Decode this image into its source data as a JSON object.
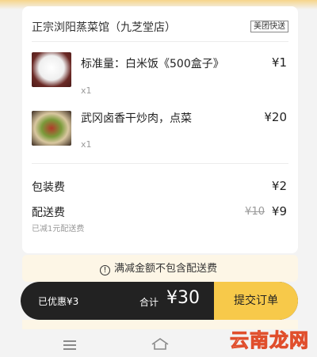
{
  "shop": {
    "name": "正宗浏阳蒸菜馆（九芝堂店）",
    "delivery_badge": "美团快送"
  },
  "items": [
    {
      "name": "标准量：白米饭《500盒子》",
      "price": "¥1",
      "qty": "x1",
      "thumb_icon": "rice-image"
    },
    {
      "name": "武冈卤香干炒肉，点菜",
      "price": "¥20",
      "qty": "x1",
      "thumb_icon": "dish-image"
    }
  ],
  "fees": {
    "packaging": {
      "label": "包装费",
      "price": "¥2"
    },
    "delivery": {
      "label": "配送费",
      "old_price": "¥10",
      "price": "¥9",
      "note": "已减1元配送费"
    }
  },
  "promo_hint": "满减金额不包含配送费",
  "bottom_bar": {
    "discount": "已优惠¥3",
    "total_label": "合计",
    "total_amount": "¥30",
    "submit_label": "提交订单"
  },
  "watermark": {
    "part1": "云南",
    "part2": "龙网"
  },
  "colors": {
    "accent": "#f7c94a",
    "bar": "#222222",
    "strip": "#fdf6e6"
  }
}
